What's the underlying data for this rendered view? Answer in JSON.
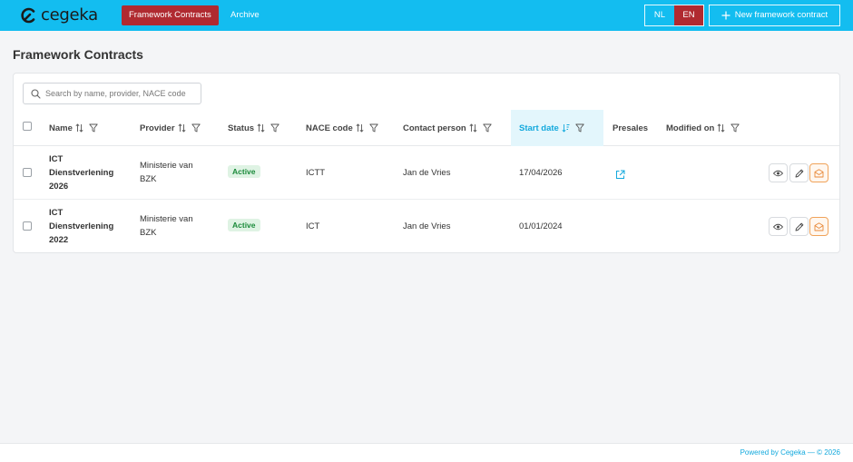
{
  "brand": {
    "name": "cegeka"
  },
  "nav": {
    "active_label": "Framework Contracts",
    "archive_label": "Archive"
  },
  "languages": [
    {
      "code": "NL",
      "active": false
    },
    {
      "code": "EN",
      "active": true
    }
  ],
  "actions": {
    "new_contract_label": "New framework contract"
  },
  "page": {
    "title": "Framework Contracts"
  },
  "search": {
    "placeholder": "Search by name, provider, NACE code",
    "value": ""
  },
  "table": {
    "columns": [
      {
        "label": "Name",
        "sortable": true,
        "filterable": true
      },
      {
        "label": "Provider",
        "sortable": true,
        "filterable": true
      },
      {
        "label": "Status",
        "sortable": true,
        "filterable": true
      },
      {
        "label": "NACE code",
        "sortable": true,
        "filterable": true
      },
      {
        "label": "Contact person",
        "sortable": true,
        "filterable": true
      },
      {
        "label": "Start date",
        "sortable": true,
        "filterable": true,
        "sorted": "desc"
      },
      {
        "label": "Presales",
        "sortable": false,
        "filterable": false
      },
      {
        "label": "Modified on",
        "sortable": true,
        "filterable": true
      }
    ],
    "rows": [
      {
        "name_lines": [
          "ICT",
          "Dienstverlening",
          "2026"
        ],
        "provider_lines": [
          "Ministerie van",
          "BZK"
        ],
        "status": "Active",
        "nace": "ICTT",
        "contact": "Jan de Vries",
        "start_date": "17/04/2026",
        "presales_link": true,
        "modified_on": ""
      },
      {
        "name_lines": [
          "ICT",
          "Dienstverlening",
          "2022"
        ],
        "provider_lines": [
          "Ministerie van",
          "BZK"
        ],
        "status": "Active",
        "nace": "ICT",
        "contact": "Jan de Vries",
        "start_date": "01/01/2024",
        "presales_link": false,
        "modified_on": ""
      }
    ]
  },
  "footer": {
    "text": "Powered by Cegeka — © 2026"
  },
  "colors": {
    "topbar": "#13bdf0",
    "accent_red": "#b02a30",
    "status_green": "#1a8a3a",
    "link_blue": "#13a9dd",
    "mail_orange": "#f0a35a"
  },
  "icons": {
    "search": "search-icon",
    "sort": "sort-icon",
    "filter": "filter-icon",
    "external_link": "external-link-icon",
    "view": "eye-icon",
    "edit": "pencil-icon",
    "mail": "mail-icon",
    "plus": "plus-icon"
  }
}
